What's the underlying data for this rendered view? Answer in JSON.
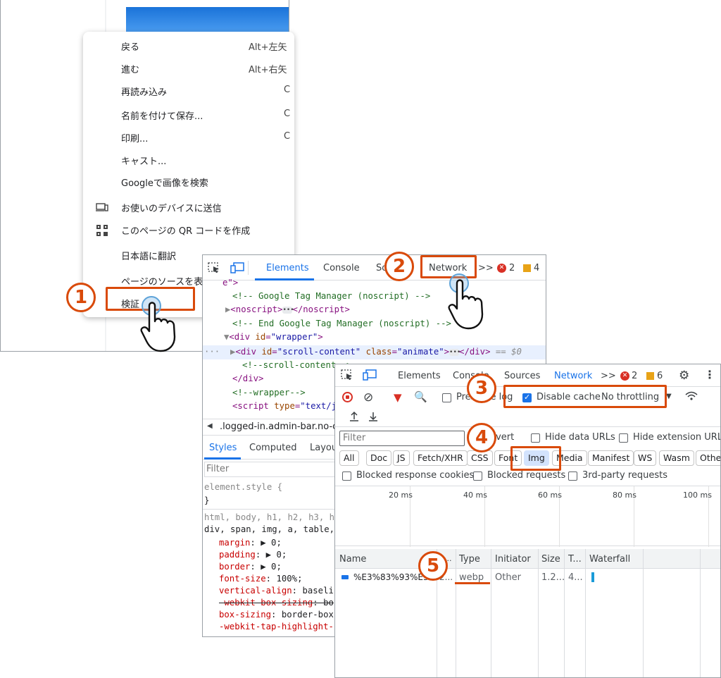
{
  "context_menu": {
    "items": [
      {
        "label": "戻る",
        "shortcut": "Alt+左矢"
      },
      {
        "label": "進む",
        "shortcut": "Alt+右矢"
      },
      {
        "label": "再読み込み",
        "shortcut": "C"
      },
      {
        "label": "名前を付けて保存...",
        "shortcut": "C"
      },
      {
        "label": "印刷...",
        "shortcut": "C"
      },
      {
        "label": "キャスト...",
        "shortcut": ""
      },
      {
        "label": "Googleで画像を検索",
        "shortcut": ""
      },
      {
        "label": "お使いのデバイスに送信",
        "shortcut": "",
        "icon": "device-send-icon"
      },
      {
        "label": "このページの QR コードを作成",
        "shortcut": "",
        "icon": "qr-code-icon"
      },
      {
        "label": "日本語に翻訳",
        "shortcut": ""
      },
      {
        "label": "ページのソースを表示",
        "shortcut": ""
      },
      {
        "label": "検証",
        "shortcut": ""
      }
    ]
  },
  "devtools_elements": {
    "tabs": [
      "Elements",
      "Console",
      "Sources",
      "Network"
    ],
    "more": ">>",
    "errors": "2",
    "warnings": "4",
    "code_lines": {
      "l0": "e\">",
      "l1": "<!-- Google Tag Manager (noscript) -->",
      "l2_tag": "<noscript>",
      "l2_end": "</noscript>",
      "l3": "<!-- End Google Tag Manager (noscript) -->",
      "l4_tag": "<div",
      "l4_attr": "id",
      "l4_val": "\"wrapper\"",
      "l4_close": ">",
      "l5_tag": "<div",
      "l5_attr1": "id",
      "l5_val1": "\"scroll-content\"",
      "l5_attr2": "class",
      "l5_val2": "\"animate\"",
      "l5_close": ">",
      "l5_end": "</div>",
      "l5_ref": "== $0",
      "l6": "<!--scroll-content-->",
      "l7": "</div>",
      "l8": "<!--wrapper-->",
      "l9_tag": "<script",
      "l9_attr": "type",
      "l9_val": "\"text/j"
    },
    "breadcrumb": ".logged-in.admin-bar.no-cu",
    "style_tabs": [
      "Styles",
      "Computed",
      "Layou"
    ],
    "filter_placeholder": "Filter",
    "css": {
      "element_style": "element.style {",
      "close": "}",
      "selector1": "html, body, h1, h2, h3, h",
      "selector2": "div, span, img, a, table,",
      "props": [
        {
          "name": "margin",
          "value": "▶ 0;"
        },
        {
          "name": "padding",
          "value": "▶ 0;"
        },
        {
          "name": "border",
          "value": "▶ 0;"
        },
        {
          "name": "font-size",
          "value": "100%;"
        },
        {
          "name": "vertical-align",
          "value": "baseli"
        },
        {
          "name": "-webkit-box-sizing",
          "value": "bo"
        },
        {
          "name": "box-sizing",
          "value": "border-box"
        },
        {
          "name": "-webkit-tap-highlight-",
          "value": ""
        }
      ]
    }
  },
  "devtools_network": {
    "tabs": [
      "Elements",
      "Console",
      "Sources",
      "Network"
    ],
    "more": ">>",
    "errors": "2",
    "warnings": "6",
    "preserve_log": "Preserve log",
    "disable_cache": "Disable cache",
    "throttling": "No throttling",
    "filter_placeholder": "Filter",
    "invert": "Invert",
    "hide_data_urls": "Hide data URLs",
    "hide_extension_urls": "Hide extension URLs",
    "type_filters": [
      "All",
      "Doc",
      "JS",
      "Fetch/XHR",
      "CSS",
      "Font",
      "Img",
      "Media",
      "Manifest",
      "WS",
      "Wasm",
      "Other"
    ],
    "selected_filter": "Img",
    "blocked_cookies": "Blocked response cookies",
    "blocked_requests": "Blocked requests",
    "third_party": "3rd-party requests",
    "timeline_labels": [
      "20 ms",
      "40 ms",
      "60 ms",
      "80 ms",
      "100 ms"
    ],
    "columns": [
      "Name",
      "S...",
      "Type",
      "Initiator",
      "Size",
      "T...",
      "Waterfall"
    ],
    "row": {
      "name": "%E3%83%93%E3...",
      "status": "2...",
      "type": "webp",
      "initiator": "Other",
      "size": "1.2...",
      "time": "4..."
    }
  },
  "annotations": {
    "step1": "1",
    "step2": "2",
    "step3": "3",
    "step4": "4",
    "step5": "5",
    "accent_color": "#d94a0a"
  }
}
